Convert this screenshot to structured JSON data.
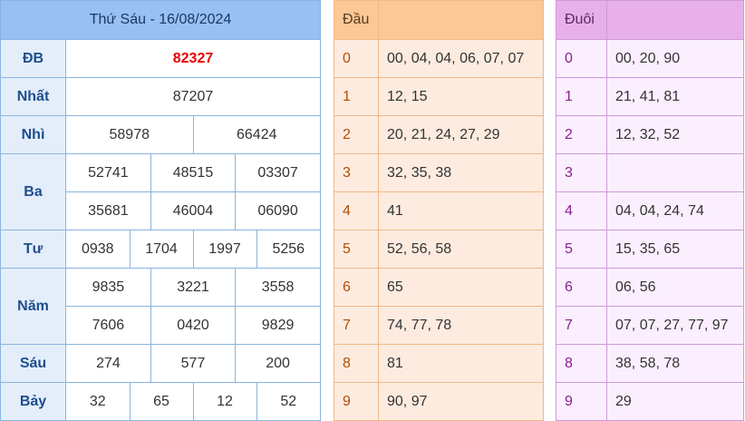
{
  "results": {
    "title": "Thứ Sáu - 16/08/2024",
    "db_label": "ĐB",
    "db": "82327",
    "nhat_label": "Nhất",
    "nhat": "87207",
    "nhi_label": "Nhì",
    "nhi": [
      "58978",
      "66424"
    ],
    "ba_label": "Ba",
    "ba": [
      "52741",
      "48515",
      "03307",
      "35681",
      "46004",
      "06090"
    ],
    "tu_label": "Tư",
    "tu": [
      "0938",
      "1704",
      "1997",
      "5256"
    ],
    "nam_label": "Năm",
    "nam": [
      "9835",
      "3221",
      "3558",
      "7606",
      "0420",
      "9829"
    ],
    "sau_label": "Sáu",
    "sau": [
      "274",
      "577",
      "200"
    ],
    "bay_label": "Bảy",
    "bay": [
      "32",
      "65",
      "12",
      "52"
    ]
  },
  "dau": {
    "header": "Đầu",
    "rows": [
      {
        "n": "0",
        "v": "00, 04, 04, 06, 07, 07"
      },
      {
        "n": "1",
        "v": "12, 15"
      },
      {
        "n": "2",
        "v": "20, 21, 24, 27, 29"
      },
      {
        "n": "3",
        "v": "32, 35, 38"
      },
      {
        "n": "4",
        "v": "41"
      },
      {
        "n": "5",
        "v": "52, 56, 58"
      },
      {
        "n": "6",
        "v": "65"
      },
      {
        "n": "7",
        "v": "74, 77, 78"
      },
      {
        "n": "8",
        "v": "81"
      },
      {
        "n": "9",
        "v": "90, 97"
      }
    ]
  },
  "duoi": {
    "header": "Đuôi",
    "rows": [
      {
        "n": "0",
        "v": "00, 20, 90"
      },
      {
        "n": "1",
        "v": "21, 41, 81"
      },
      {
        "n": "2",
        "v": "12, 32, 52"
      },
      {
        "n": "3",
        "v": ""
      },
      {
        "n": "4",
        "v": "04, 04, 24, 74"
      },
      {
        "n": "5",
        "v": "15, 35, 65"
      },
      {
        "n": "6",
        "v": "06, 56"
      },
      {
        "n": "7",
        "v": "07, 07, 27, 77, 97"
      },
      {
        "n": "8",
        "v": "38, 58, 78"
      },
      {
        "n": "9",
        "v": "29"
      }
    ]
  }
}
